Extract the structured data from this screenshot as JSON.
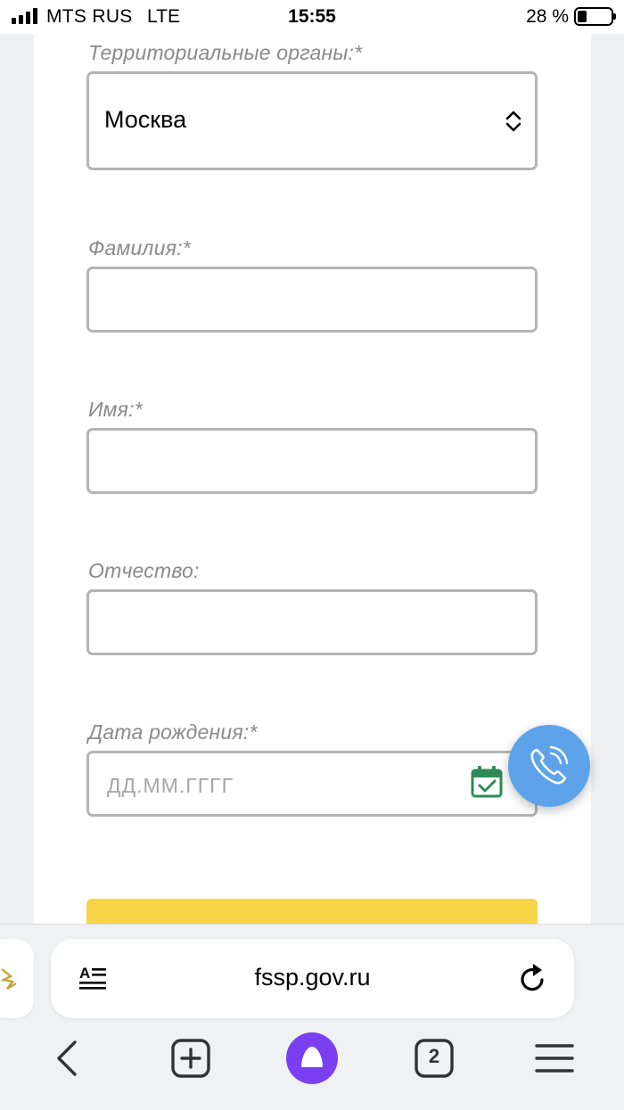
{
  "status_bar": {
    "carrier": "MTS RUS",
    "network": "LTE",
    "time": "15:55",
    "battery_percent": "28 %",
    "battery_level": 0.28
  },
  "form": {
    "territorial_label": "Территориальные органы:*",
    "territorial_value": "Москва",
    "surname_label": "Фамилия:*",
    "surname_value": "",
    "name_label": "Имя:*",
    "name_value": "",
    "patronymic_label": "Отчество:",
    "patronymic_value": "",
    "birthdate_label": "Дата рождения:*",
    "birthdate_placeholder": "ДД.ММ.ГГГГ"
  },
  "colors": {
    "submit_button": "#f5d547",
    "call_button": "#5ea3ea",
    "calendar_icon": "#2e8b57",
    "alice_button": "#7b3ff2"
  },
  "browser": {
    "url": "fssp.gov.ru",
    "tab_count": "2"
  },
  "icons": [
    "reader-mode-icon",
    "reload-icon",
    "back-icon",
    "new-tab-icon",
    "alice-icon",
    "tabs-icon",
    "menu-icon",
    "phone-icon",
    "calendar-icon",
    "select-arrows-icon"
  ]
}
